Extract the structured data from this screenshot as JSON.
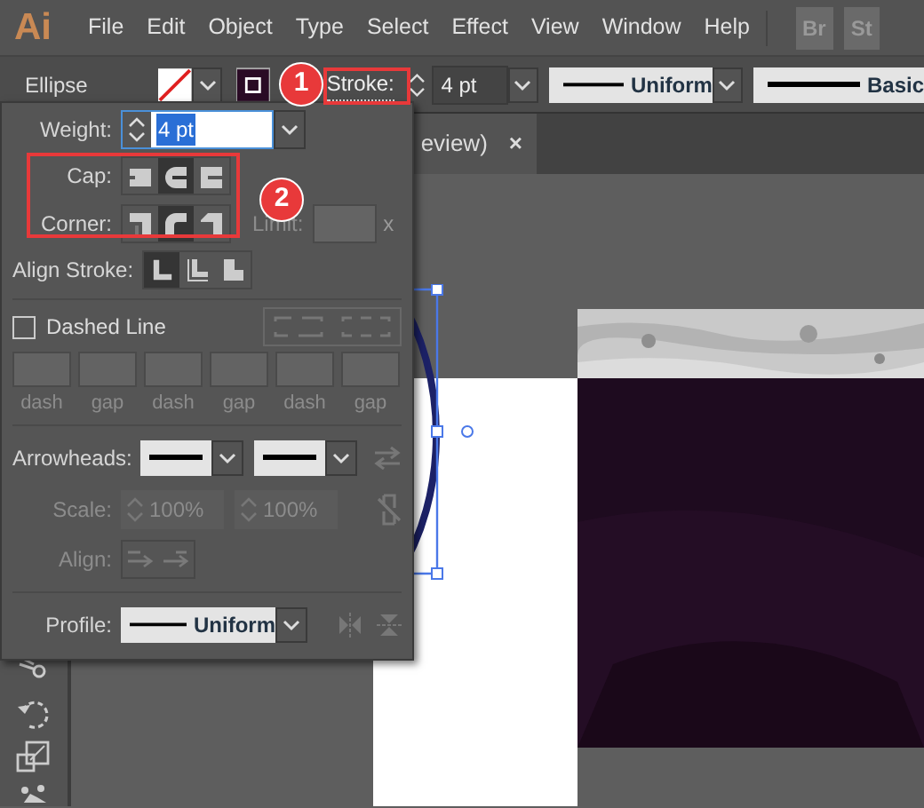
{
  "app_bar": {
    "logo": "Ai",
    "menu": [
      "File",
      "Edit",
      "Object",
      "Type",
      "Select",
      "Effect",
      "View",
      "Window",
      "Help"
    ],
    "app_buttons": [
      "Br",
      "St"
    ]
  },
  "control_bar": {
    "object_type": "Ellipse",
    "stroke_label": "Stroke:",
    "stroke_weight": "4 pt",
    "profile": "Uniform",
    "brush": "Basic"
  },
  "document_tab": {
    "title": "eview)",
    "close": "×"
  },
  "stroke_panel": {
    "weight": {
      "label": "Weight:",
      "value": "4 pt",
      "text_selected": true
    },
    "cap": {
      "label": "Cap:",
      "options": [
        {
          "kind": "butt",
          "selected": false
        },
        {
          "kind": "round",
          "selected": true
        },
        {
          "kind": "projecting",
          "selected": false
        }
      ]
    },
    "corner": {
      "label": "Corner:",
      "options": [
        {
          "kind": "miter",
          "selected": false
        },
        {
          "kind": "round",
          "selected": true
        },
        {
          "kind": "bevel",
          "selected": false
        }
      ]
    },
    "limit": {
      "label": "Limit:",
      "unit": "x",
      "disabled": true
    },
    "align_stroke": {
      "label": "Align Stroke:",
      "options": [
        {
          "kind": "center",
          "selected": true
        },
        {
          "kind": "inside",
          "selected": false
        },
        {
          "kind": "outside",
          "selected": false
        }
      ]
    },
    "dashed_line": {
      "label": "Dashed Line",
      "checked": false,
      "fields": [
        {
          "label": "dash",
          "disabled": true
        },
        {
          "label": "gap",
          "disabled": true
        },
        {
          "label": "dash",
          "disabled": true
        },
        {
          "label": "gap",
          "disabled": true
        },
        {
          "label": "dash",
          "disabled": true
        },
        {
          "label": "gap",
          "disabled": true
        }
      ]
    },
    "arrowheads": {
      "label": "Arrowheads:"
    },
    "scale": {
      "label": "Scale:",
      "start": "100%",
      "end": "100%",
      "disabled": true
    },
    "align": {
      "label": "Align:",
      "disabled": true
    },
    "profile": {
      "label": "Profile:",
      "value": "Uniform"
    }
  },
  "annotations": [
    {
      "number": "1"
    },
    {
      "number": "2"
    }
  ]
}
